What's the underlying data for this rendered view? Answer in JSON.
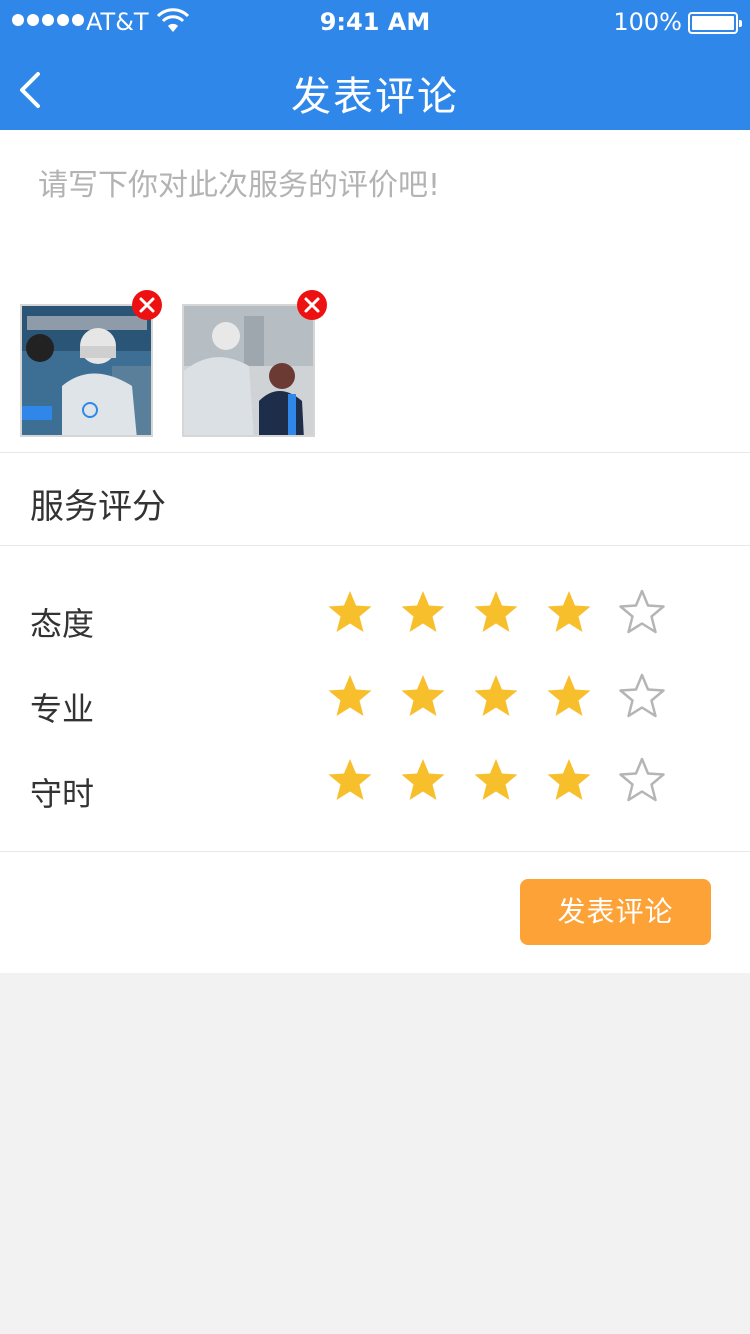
{
  "status_bar": {
    "carrier": "AT&T",
    "time": "9:41 AM",
    "battery": "100%"
  },
  "nav": {
    "title": "发表评论",
    "back_icon": "chevron-left-icon"
  },
  "comment": {
    "placeholder": "请写下你对此次服务的评价吧!",
    "value": ""
  },
  "photos": [
    {
      "name": "photo-1",
      "description_icon": "technician-photo"
    },
    {
      "name": "photo-2",
      "description_icon": "technician-customer-photo"
    }
  ],
  "rating_section": {
    "title": "服务评分",
    "rows": [
      {
        "label": "态度",
        "rating": 4,
        "max": 5
      },
      {
        "label": "专业",
        "rating": 4,
        "max": 5
      },
      {
        "label": "守时",
        "rating": 4,
        "max": 5
      }
    ]
  },
  "submit_label": "发表评论",
  "colors": {
    "primary": "#2f87ea",
    "accent": "#fca237",
    "star_filled": "#f8bf2c",
    "star_empty": "#b5b5b5",
    "delete": "#ee1111"
  }
}
